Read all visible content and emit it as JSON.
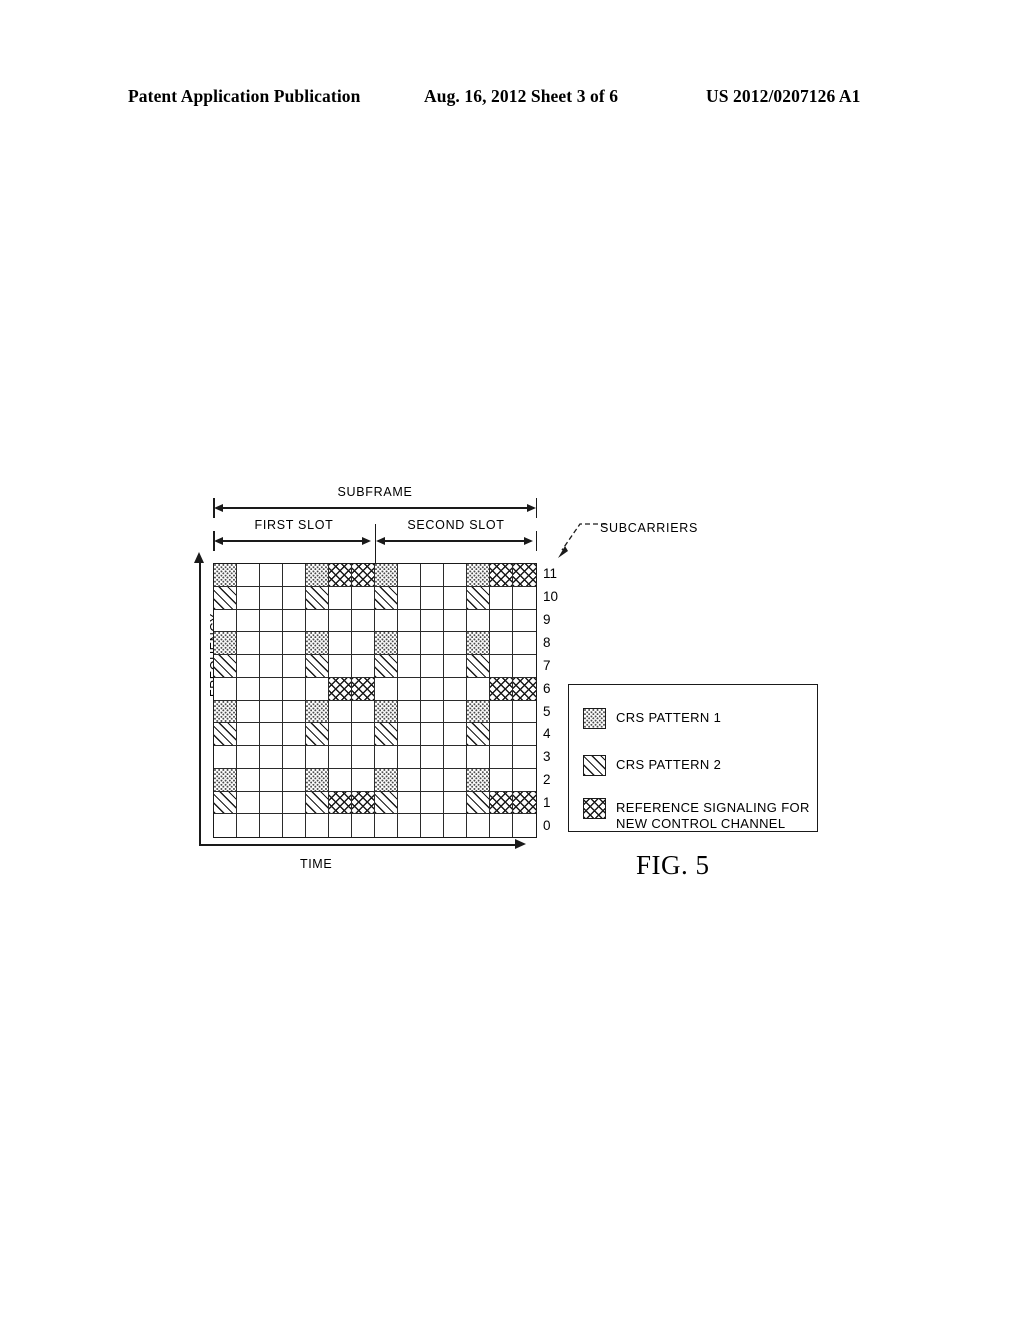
{
  "page_header": {
    "left": "Patent Application Publication",
    "middle": "Aug. 16, 2012  Sheet 3 of 6",
    "right": "US 2012/0207126 A1"
  },
  "figure": {
    "caption": "FIG. 5",
    "axes": {
      "y_label": "FREQUENCY",
      "x_label": "TIME"
    },
    "spans": {
      "subframe": "SUBFRAME",
      "first_slot": "FIRST SLOT",
      "second_slot": "SECOND SLOT"
    },
    "callout": {
      "subcarriers": "SUBCARRIERS"
    },
    "subcarrier_indices": [
      "11",
      "10",
      "9",
      "8",
      "7",
      "6",
      "5",
      "4",
      "3",
      "2",
      "1",
      "0"
    ],
    "legend": {
      "items": [
        {
          "pattern": "dot",
          "label": "CRS PATTERN 1"
        },
        {
          "pattern": "diag",
          "label": "CRS PATTERN 2"
        },
        {
          "pattern": "cross",
          "label": "REFERENCE SIGNALING FOR\nNEW CONTROL CHANNEL"
        }
      ]
    }
  },
  "chart_data": {
    "type": "heatmap",
    "title": "FIG. 5",
    "xlabel": "TIME",
    "ylabel": "FREQUENCY",
    "x_count": 14,
    "y_count": 12,
    "x_description": "OFDM symbols 0-13 (two slots of 7 symbols)",
    "y_tick_labels": [
      "11",
      "10",
      "9",
      "8",
      "7",
      "6",
      "5",
      "4",
      "3",
      "2",
      "1",
      "0"
    ],
    "grid": true,
    "legend_position": "right",
    "categories": [
      "empty",
      "dot",
      "diag",
      "cross"
    ],
    "category_labels": {
      "empty": "",
      "dot": "CRS PATTERN 1",
      "diag": "CRS PATTERN 2",
      "cross": "REFERENCE SIGNALING FOR NEW CONTROL CHANNEL"
    },
    "rows_top_to_bottom": [
      {
        "subcarrier": 11,
        "cells": [
          "dot",
          "",
          "",
          "",
          "dot",
          "cross",
          "cross",
          "dot",
          "",
          "",
          "",
          "dot",
          "cross",
          "cross"
        ]
      },
      {
        "subcarrier": 10,
        "cells": [
          "diag",
          "",
          "",
          "",
          "diag",
          "",
          "",
          "diag",
          "",
          "",
          "",
          "diag",
          "",
          ""
        ]
      },
      {
        "subcarrier": 9,
        "cells": [
          "",
          "",
          "",
          "",
          "",
          "",
          "",
          "",
          "",
          "",
          "",
          "",
          "",
          ""
        ]
      },
      {
        "subcarrier": 8,
        "cells": [
          "dot",
          "",
          "",
          "",
          "dot",
          "",
          "",
          "dot",
          "",
          "",
          "",
          "dot",
          "",
          ""
        ]
      },
      {
        "subcarrier": 7,
        "cells": [
          "diag",
          "",
          "",
          "",
          "diag",
          "",
          "",
          "diag",
          "",
          "",
          "",
          "diag",
          "",
          ""
        ]
      },
      {
        "subcarrier": 6,
        "cells": [
          "",
          "",
          "",
          "",
          "",
          "cross",
          "cross",
          "",
          "",
          "",
          "",
          "",
          "cross",
          "cross"
        ]
      },
      {
        "subcarrier": 5,
        "cells": [
          "dot",
          "",
          "",
          "",
          "dot",
          "",
          "",
          "dot",
          "",
          "",
          "",
          "dot",
          "",
          ""
        ]
      },
      {
        "subcarrier": 4,
        "cells": [
          "diag",
          "",
          "",
          "",
          "diag",
          "",
          "",
          "diag",
          "",
          "",
          "",
          "diag",
          "",
          ""
        ]
      },
      {
        "subcarrier": 3,
        "cells": [
          "",
          "",
          "",
          "",
          "",
          "",
          "",
          "",
          "",
          "",
          "",
          "",
          "",
          ""
        ]
      },
      {
        "subcarrier": 2,
        "cells": [
          "dot",
          "",
          "",
          "",
          "dot",
          "",
          "",
          "dot",
          "",
          "",
          "",
          "dot",
          "",
          ""
        ]
      },
      {
        "subcarrier": 1,
        "cells": [
          "diag",
          "",
          "",
          "",
          "diag",
          "cross",
          "cross",
          "diag",
          "",
          "",
          "",
          "diag",
          "cross",
          "cross"
        ]
      },
      {
        "subcarrier": 0,
        "cells": [
          "",
          "",
          "",
          "",
          "",
          "",
          "",
          "",
          "",
          "",
          "",
          "",
          "",
          ""
        ]
      }
    ]
  }
}
